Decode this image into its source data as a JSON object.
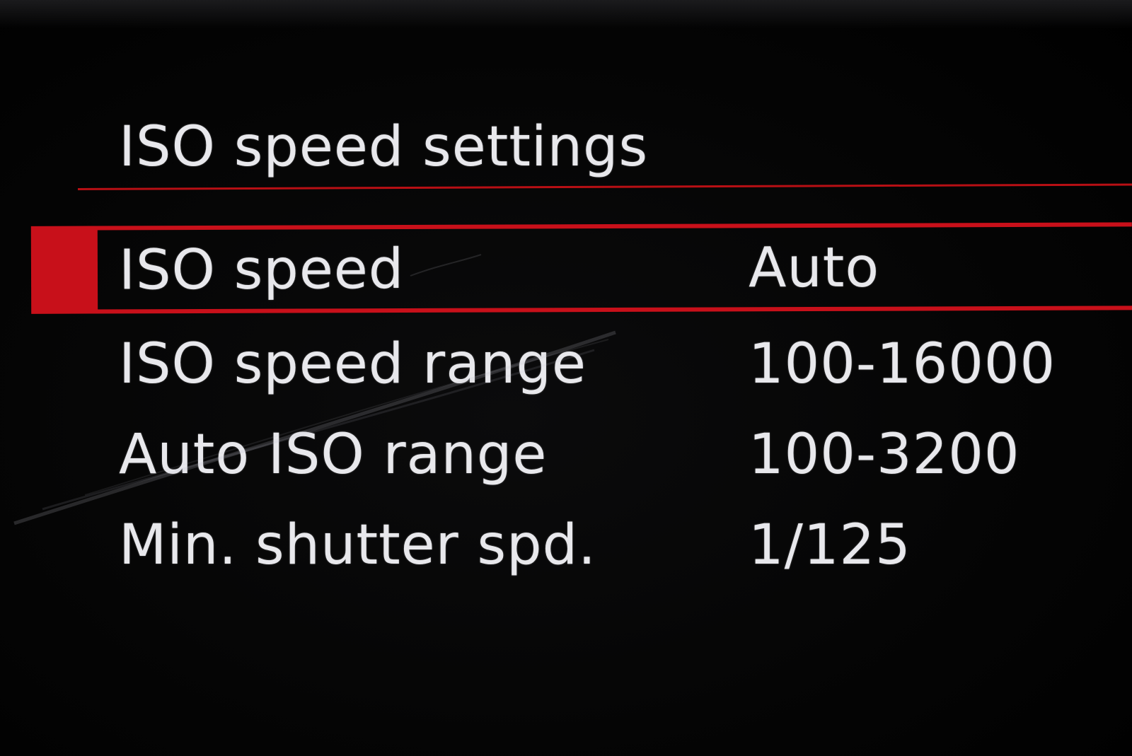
{
  "screen": {
    "title": "ISO speed settings",
    "accent_color": "#c8101a",
    "background_color": "#000000",
    "text_color": "#e8e8ec"
  },
  "menu": {
    "selected_index": 0,
    "items": [
      {
        "label": "ISO speed",
        "value": "Auto"
      },
      {
        "label": "ISO speed range",
        "value": "100-16000"
      },
      {
        "label": "Auto ISO range",
        "value": "100-3200"
      },
      {
        "label": "Min. shutter spd.",
        "value": "1/125"
      }
    ]
  }
}
